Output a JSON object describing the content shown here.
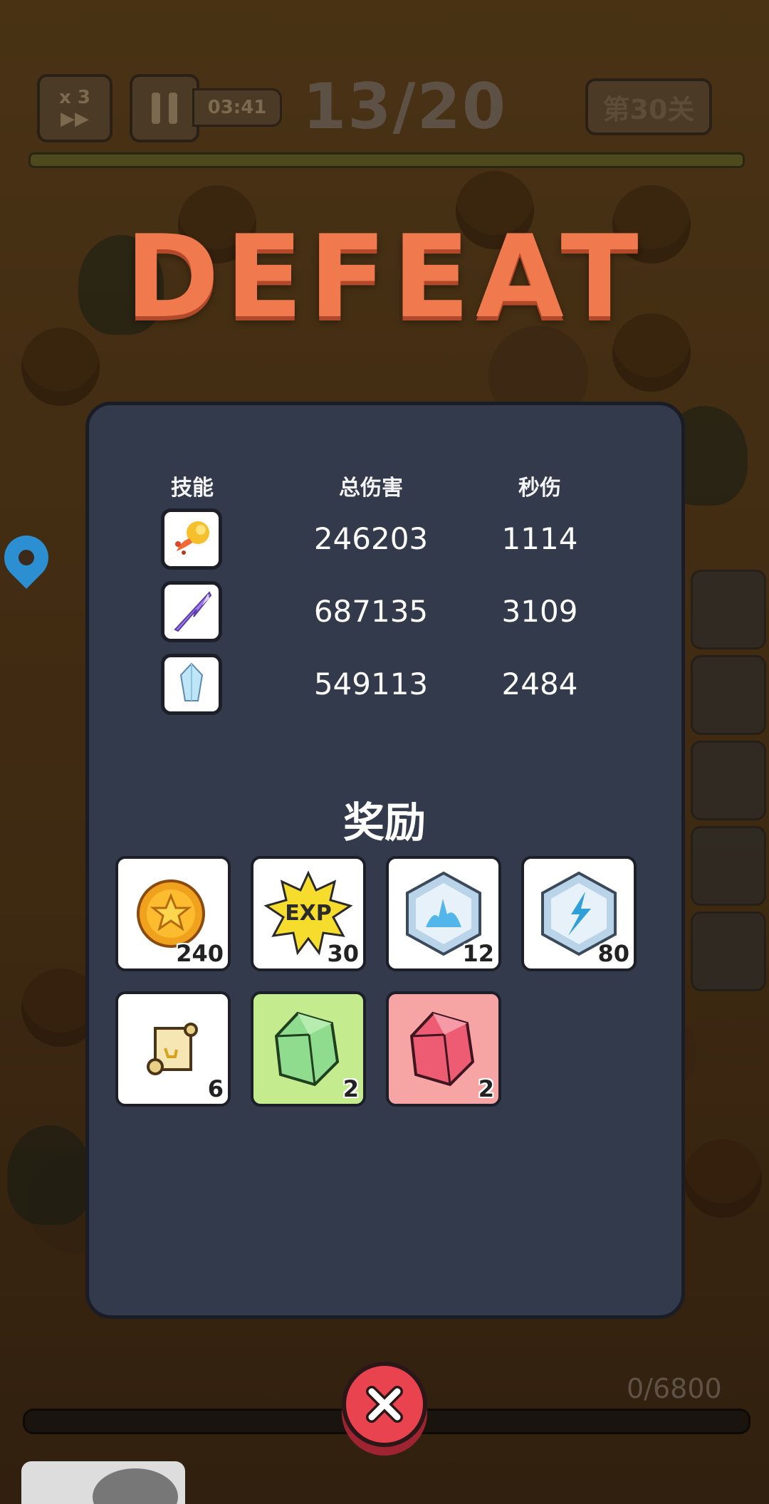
{
  "hud": {
    "speed_label": "x 3",
    "speed_icon": "fast-forward-icon",
    "timer": "03:41",
    "wave_progress": "13/20",
    "level_label": "第30关"
  },
  "result": {
    "title": "DEFEAT"
  },
  "stats": {
    "headers": {
      "skill": "技能",
      "total_damage": "总伤害",
      "dps": "秒伤"
    },
    "rows": [
      {
        "skill_icon": "fireball-icon",
        "total_damage": "246203",
        "dps": "1114"
      },
      {
        "skill_icon": "lightning-arrow-icon",
        "total_damage": "687135",
        "dps": "3109"
      },
      {
        "skill_icon": "ice-crystal-icon",
        "total_damage": "549113",
        "dps": "2484"
      }
    ]
  },
  "rewards": {
    "title": "奖励",
    "exp_label": "EXP",
    "items": [
      {
        "icon": "gold-coin-icon",
        "count": "240",
        "bg": "#ffffff"
      },
      {
        "icon": "exp-burst-icon",
        "count": "30",
        "bg": "#ffffff"
      },
      {
        "icon": "ice-rune-icon",
        "count": "12",
        "bg": "#ffffff"
      },
      {
        "icon": "lightning-rune-icon",
        "count": "80",
        "bg": "#ffffff"
      },
      {
        "icon": "scroll-icon",
        "count": "6",
        "bg": "#ffffff"
      },
      {
        "icon": "green-gem-icon",
        "count": "2",
        "bg": "#c4ec8e"
      },
      {
        "icon": "red-gem-icon",
        "count": "2",
        "bg": "#f7a4a4"
      }
    ]
  },
  "bottom": {
    "progress_text": "0/6800"
  },
  "colors": {
    "defeat_title": "#f07a4e",
    "panel_bg": "#323a4b",
    "close_button": "#e8434e"
  }
}
